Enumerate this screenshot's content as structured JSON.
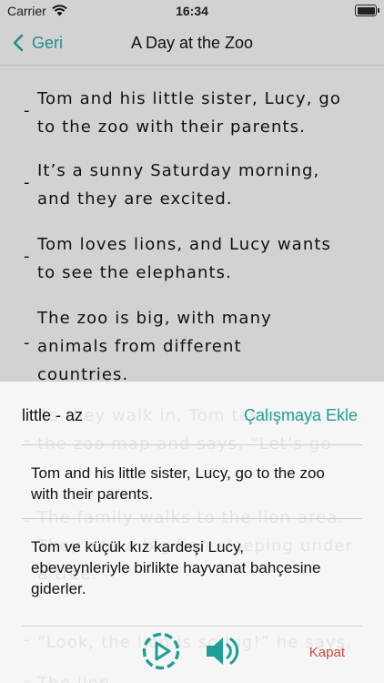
{
  "status_bar": {
    "carrier": "Carrier",
    "time": "16:34"
  },
  "nav": {
    "back_label": "Geri",
    "title": "A Day at the Zoo"
  },
  "content": {
    "dash": "-",
    "paragraphs": [
      "Tom and his little sister, Lucy, go\nto the zoo with their parents.",
      "It’s a sunny Saturday morning,\nand they are excited.",
      "Tom loves lions, and Lucy wants\nto see the elephants.",
      "The zoo is big, with many\nanimals from different\ncountries."
    ],
    "faded_paragraphs": [
      "As they walk in, Tom takes out\nthe zoo map and says, “Let’s go",
      "The family walks to the lion area.\nThey see a big lion sleeping under\na tree.",
      "“Look, the lion is so big!” he says.",
      "The lion..."
    ]
  },
  "sheet": {
    "word": "little - az",
    "add_label": "Çalışmaya Ekle",
    "source_sentence": "Tom and his little sister, Lucy, go to the zoo with their parents.",
    "translation": "Tom ve küçük kız kardeşi Lucy, ebeveynleriyle birlikte hayvanat bahçesine giderler.",
    "close_label": "Kapat"
  },
  "colors": {
    "accent": "#1f9e94",
    "close": "#d0473e",
    "back": "#1f8f88"
  },
  "icons": [
    "wifi-icon",
    "battery-icon",
    "chevron-left-icon",
    "play-icon",
    "speaker-icon"
  ]
}
